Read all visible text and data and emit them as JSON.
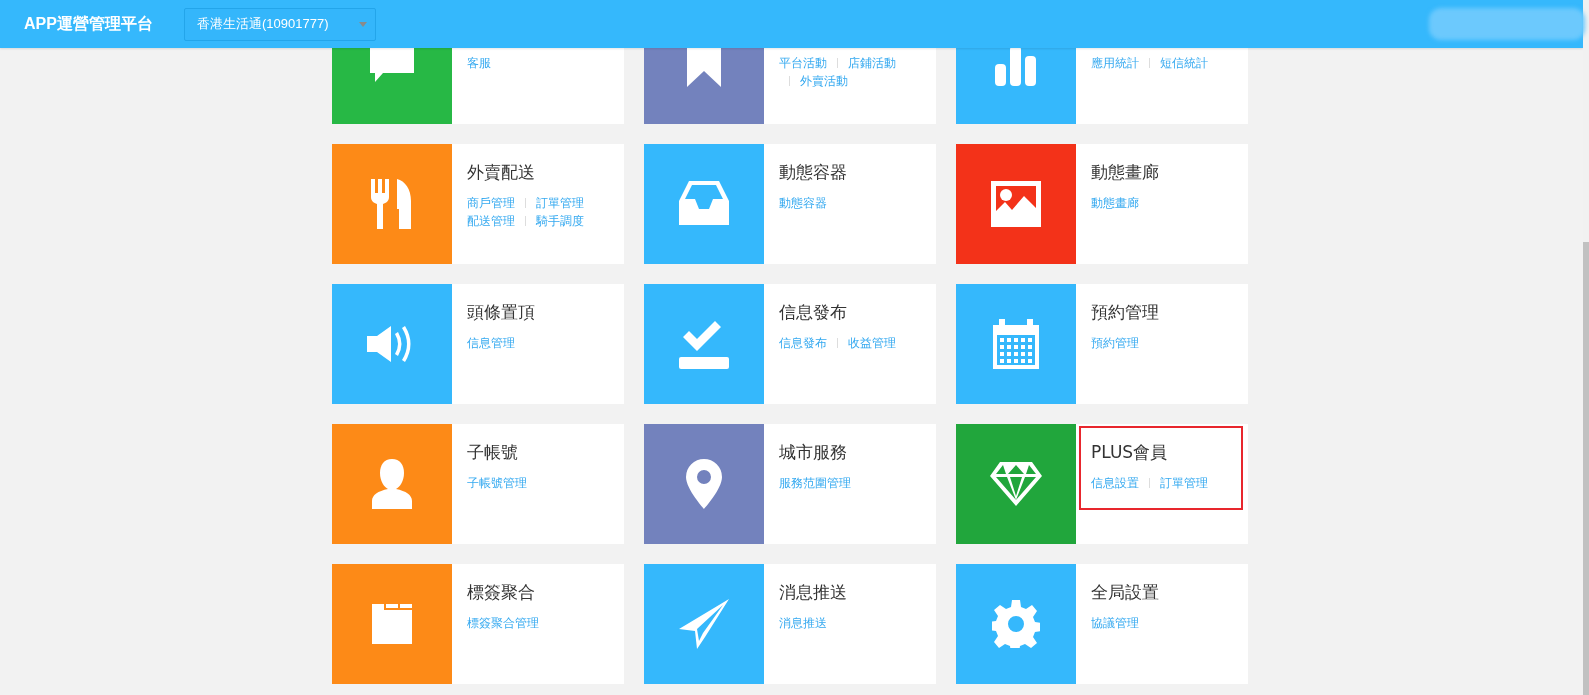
{
  "header": {
    "title": "APP運營管理平台",
    "account_select": {
      "value": "香港生活通(10901777)"
    }
  },
  "cards": [
    {
      "kind": "chat",
      "color": "#27b845",
      "lines": [
        [
          {
            "label": "客服",
            "divider": false
          }
        ]
      ],
      "highlighted": false
    },
    {
      "kind": "bookmark",
      "color": "#7382bd",
      "lines": [
        [
          {
            "label": "平台活動",
            "divider": false
          },
          {
            "label": "店鋪活動",
            "divider": true
          }
        ],
        [
          {
            "label": "外賣活動",
            "divider": true
          }
        ]
      ],
      "highlighted": false
    },
    {
      "kind": "chart",
      "color": "#35b8fc",
      "lines": [
        [
          {
            "label": "應用統計",
            "divider": false
          },
          {
            "label": "短信統計",
            "divider": true
          }
        ]
      ],
      "highlighted": false
    },
    {
      "kind": "cutlery",
      "color": "#fd8a17",
      "title": "外賣配送",
      "lines": [
        [
          {
            "label": "商戶管理",
            "divider": false
          },
          {
            "label": "訂單管理",
            "divider": true
          }
        ],
        [
          {
            "label": "配送管理",
            "divider": false
          },
          {
            "label": "騎手調度",
            "divider": true
          }
        ]
      ],
      "highlighted": false
    },
    {
      "kind": "inbox",
      "color": "#35b8fc",
      "title": "動態容器",
      "lines": [
        [
          {
            "label": "動態容器",
            "divider": false
          }
        ]
      ],
      "highlighted": false
    },
    {
      "kind": "image",
      "color": "#f33219",
      "title": "動態畫廊",
      "lines": [
        [
          {
            "label": "動態畫廊",
            "divider": false
          }
        ]
      ],
      "highlighted": false
    },
    {
      "kind": "speaker",
      "color": "#35b8fc",
      "title": "頭條置頂",
      "lines": [
        [
          {
            "label": "信息管理",
            "divider": false
          }
        ]
      ],
      "highlighted": false
    },
    {
      "kind": "check",
      "color": "#35b8fc",
      "title": "信息發布",
      "lines": [
        [
          {
            "label": "信息發布",
            "divider": false
          },
          {
            "label": "收益管理",
            "divider": true
          }
        ]
      ],
      "highlighted": false
    },
    {
      "kind": "calendar",
      "color": "#35b8fc",
      "title": "預約管理",
      "lines": [
        [
          {
            "label": "預約管理",
            "divider": false
          }
        ]
      ],
      "highlighted": false
    },
    {
      "kind": "person",
      "color": "#fd8a17",
      "title": "子帳號",
      "lines": [
        [
          {
            "label": "子帳號管理",
            "divider": false
          }
        ]
      ],
      "highlighted": false
    },
    {
      "kind": "pin",
      "color": "#7382bd",
      "title": "城市服務",
      "lines": [
        [
          {
            "label": "服務范圍管理",
            "divider": false
          }
        ]
      ],
      "highlighted": false
    },
    {
      "kind": "diamond",
      "color": "#21a63c",
      "title": "PLUS會員",
      "lines": [
        [
          {
            "label": "信息設置",
            "divider": false
          },
          {
            "label": "訂單管理",
            "divider": true
          }
        ]
      ],
      "highlighted": true
    },
    {
      "kind": "folder",
      "color": "#fd8a17",
      "title": "標簽聚合",
      "lines": [
        [
          {
            "label": "標簽聚合管理",
            "divider": false
          }
        ]
      ],
      "highlighted": false
    },
    {
      "kind": "plane",
      "color": "#35b8fc",
      "title": "消息推送",
      "lines": [
        [
          {
            "label": "消息推送",
            "divider": false
          }
        ]
      ],
      "highlighted": false
    },
    {
      "kind": "gear",
      "color": "#35b8fc",
      "title": "全局設置",
      "lines": [
        [
          {
            "label": "協議管理",
            "divider": false
          }
        ]
      ],
      "highlighted": false
    }
  ]
}
